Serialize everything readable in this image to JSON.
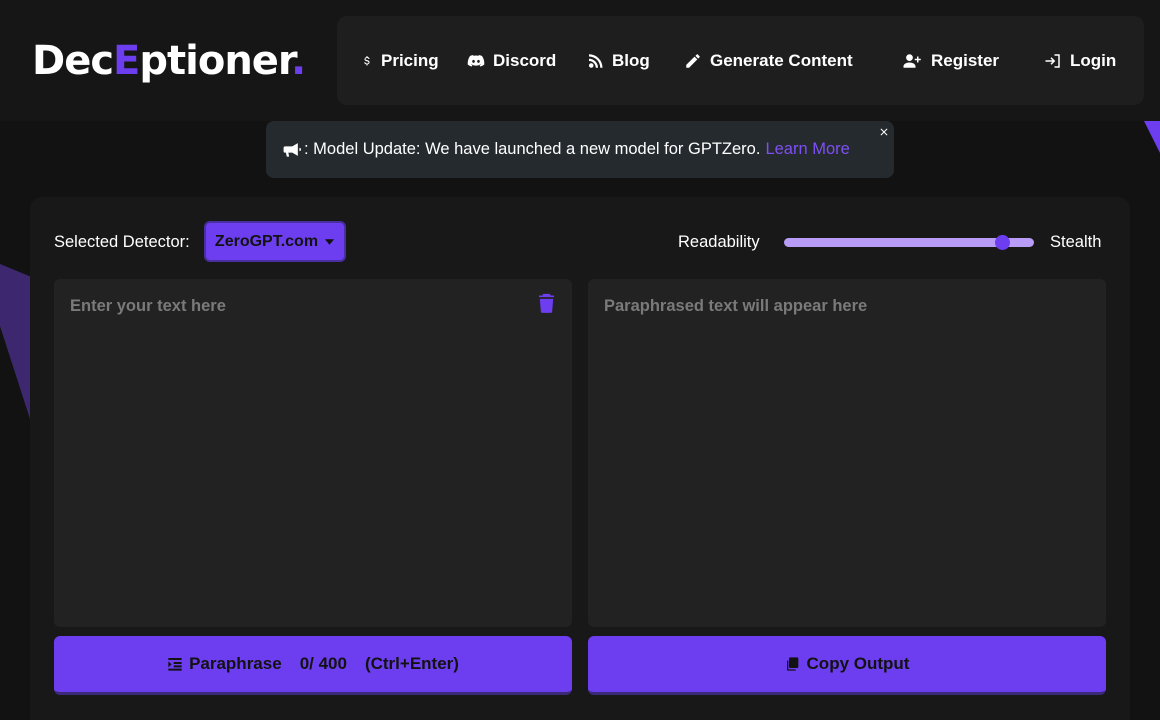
{
  "header": {
    "logo": {
      "part1": "Dec",
      "accent": "E",
      "part2": "ptioner",
      "dot": "."
    },
    "nav": [
      {
        "label": "Pricing",
        "icon": "dollar-icon"
      },
      {
        "label": "Discord",
        "icon": "discord-icon"
      },
      {
        "label": "Blog",
        "icon": "blog-icon"
      },
      {
        "label": "Generate Content",
        "icon": "pen-icon"
      },
      {
        "label": "Register",
        "icon": "user-plus-icon"
      },
      {
        "label": "Login",
        "icon": "login-icon"
      }
    ]
  },
  "announcement": {
    "icon": "megaphone-icon",
    "text": ": Model Update: We have launched a new model for GPTZero.",
    "link": "Learn More"
  },
  "controls": {
    "detector_label": "Selected Detector:",
    "detector_value": "ZeroGPT.com",
    "slider_left": "Readability",
    "slider_right": "Stealth",
    "slider_value": 0.87
  },
  "input": {
    "placeholder": "Enter your text here",
    "value": ""
  },
  "output": {
    "placeholder": "Paraphrased text will appear here",
    "value": ""
  },
  "actions": {
    "paraphrase_label": "Paraphrase",
    "count": "0/ 400",
    "shortcut": "(Ctrl+Enter)",
    "copy_label": "Copy Output"
  },
  "colors": {
    "accent": "#6d3ef0",
    "background": "#121212",
    "panel": "#181818"
  }
}
